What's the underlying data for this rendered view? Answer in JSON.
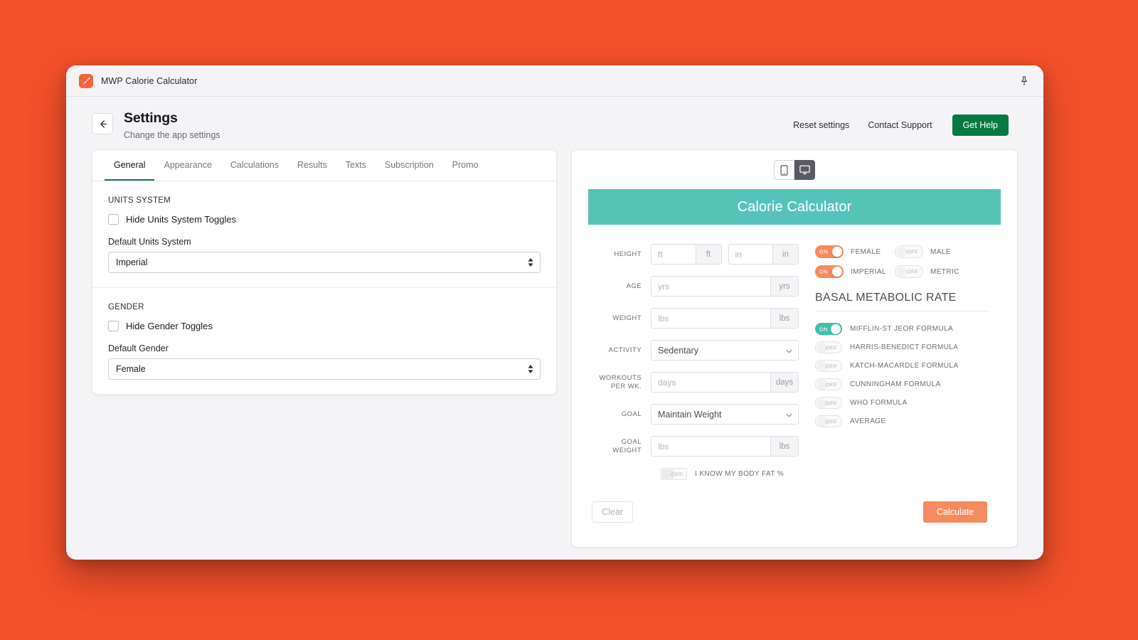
{
  "window": {
    "title": "MWP Calorie Calculator",
    "app_icon": "carrot-icon",
    "pin_icon": "pin-icon"
  },
  "header": {
    "back_icon": "arrow-left-icon",
    "title": "Settings",
    "subtitle": "Change the app settings",
    "links": [
      {
        "label": "Reset settings"
      },
      {
        "label": "Contact Support"
      }
    ],
    "primary_button": "Get Help",
    "primary_color": "#067a45"
  },
  "tabs": [
    {
      "label": "General",
      "active": true
    },
    {
      "label": "Appearance",
      "active": false
    },
    {
      "label": "Calculations",
      "active": false
    },
    {
      "label": "Results",
      "active": false
    },
    {
      "label": "Texts",
      "active": false
    },
    {
      "label": "Subscription",
      "active": false
    },
    {
      "label": "Promo",
      "active": false
    }
  ],
  "settings": {
    "units": {
      "section_label": "UNITS SYSTEM",
      "checkbox_label": "Hide Units System Toggles",
      "checked": false,
      "field_label": "Default Units System",
      "value": "Imperial"
    },
    "gender": {
      "section_label": "GENDER",
      "checkbox_label": "Hide Gender Toggles",
      "checked": false,
      "field_label": "Default Gender",
      "value": "Female"
    }
  },
  "preview": {
    "device_mobile_icon": "mobile-icon",
    "device_desktop_icon": "desktop-icon",
    "active_device": "desktop",
    "calculator": {
      "title": "Calorie Calculator",
      "header_color": "#56c3bb",
      "fields": [
        {
          "label": "HEIGHT",
          "type": "dual-input",
          "inputs": [
            {
              "placeholder": "ft",
              "unit": "ft",
              "value": ""
            },
            {
              "placeholder": "in",
              "unit": "in",
              "value": ""
            }
          ]
        },
        {
          "label": "AGE",
          "type": "input",
          "placeholder": "yrs",
          "unit": "yrs",
          "value": ""
        },
        {
          "label": "WEIGHT",
          "type": "input",
          "placeholder": "lbs",
          "unit": "lbs",
          "value": ""
        },
        {
          "label": "ACTIVITY",
          "type": "select",
          "value": "Sedentary"
        },
        {
          "label": "WORKOUTS PER WK.",
          "type": "input",
          "placeholder": "days",
          "unit": "days",
          "value": ""
        },
        {
          "label": "GOAL",
          "type": "select",
          "value": "Maintain Weight"
        },
        {
          "label": "GOAL WEIGHT",
          "type": "input",
          "placeholder": "lbs",
          "unit": "lbs",
          "value": ""
        }
      ],
      "body_fat": {
        "state": "OFF",
        "label": "I KNOW MY BODY FAT %"
      },
      "gender_toggles": [
        {
          "state": "ON",
          "label": "FEMALE",
          "on": true
        },
        {
          "state": "OFF",
          "label": "MALE",
          "on": false
        }
      ],
      "units_toggles": [
        {
          "state": "ON",
          "label": "IMPERIAL",
          "on": true
        },
        {
          "state": "OFF",
          "label": "METRIC",
          "on": false
        }
      ],
      "bmr": {
        "title": "BASAL METABOLIC RATE",
        "formulas": [
          {
            "state": "ON",
            "label": "MIFFLIN-ST JEOR FORMULA",
            "on": true
          },
          {
            "state": "OFF",
            "label": "HARRIS-BENEDICT FORMULA",
            "on": false
          },
          {
            "state": "OFF",
            "label": "KATCH-MACARDLE FORMULA",
            "on": false
          },
          {
            "state": "OFF",
            "label": "CUNNINGHAM FORMULA",
            "on": false
          },
          {
            "state": "OFF",
            "label": "WHO FORMULA",
            "on": false
          },
          {
            "state": "OFF",
            "label": "AVERAGE",
            "on": false
          }
        ]
      },
      "clear_button": "Clear",
      "calculate_button": "Calculate",
      "accent_color": "#f68b5f"
    }
  }
}
